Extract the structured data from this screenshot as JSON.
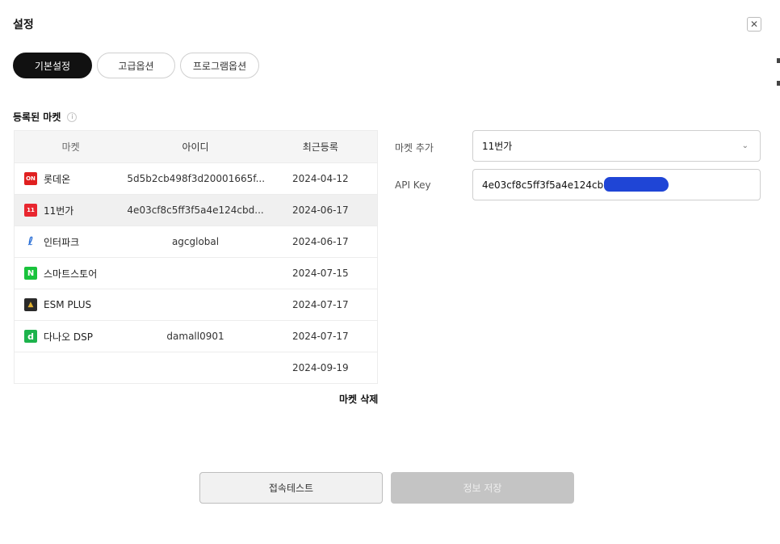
{
  "header": {
    "title": "설정",
    "close_icon": "close-icon"
  },
  "tabs": [
    {
      "label": "기본설정",
      "active": true
    },
    {
      "label": "고급옵션",
      "active": false
    },
    {
      "label": "프로그램옵션",
      "active": false
    }
  ],
  "markets_section": {
    "label": "등록된 마켓",
    "info_icon": "i"
  },
  "table": {
    "columns": [
      "마켓",
      "아이디",
      "최근등록"
    ],
    "rows": [
      {
        "market": "롯데온",
        "logo": "ON",
        "id": "5d5b2cb498f3d20001665f...",
        "date": "2024-04-12"
      },
      {
        "market": "11번가",
        "logo": "11",
        "id": "4e03cf8c5ff3f5a4e124cbd...",
        "date": "2024-06-17",
        "selected": true
      },
      {
        "market": "인터파크",
        "logo": "ℓ",
        "id": "agcglobal",
        "date": "2024-06-17"
      },
      {
        "market": "스마트스토어",
        "logo": "N",
        "id": "",
        "date": "2024-07-15"
      },
      {
        "market": "ESM PLUS",
        "logo": "▲",
        "id": "",
        "date": "2024-07-17"
      },
      {
        "market": "다나오 DSP",
        "logo": "d",
        "id": "damall0901",
        "date": "2024-07-17"
      },
      {
        "market": "",
        "logo": "",
        "id": "",
        "date": "2024-09-19"
      }
    ]
  },
  "delete_label": "마켓 삭제",
  "form": {
    "add_market_label": "마켓 추가",
    "add_market_value": "11번가",
    "api_key_label": "API Key",
    "api_key_value": "4e03cf8c5ff3f5a4e124cbd"
  },
  "buttons": {
    "test": "접속테스트",
    "save": "정보 저장"
  },
  "colors": {
    "accent": "#111111",
    "redaction": "#1f45d6",
    "disabled": "#c4c4c4"
  }
}
